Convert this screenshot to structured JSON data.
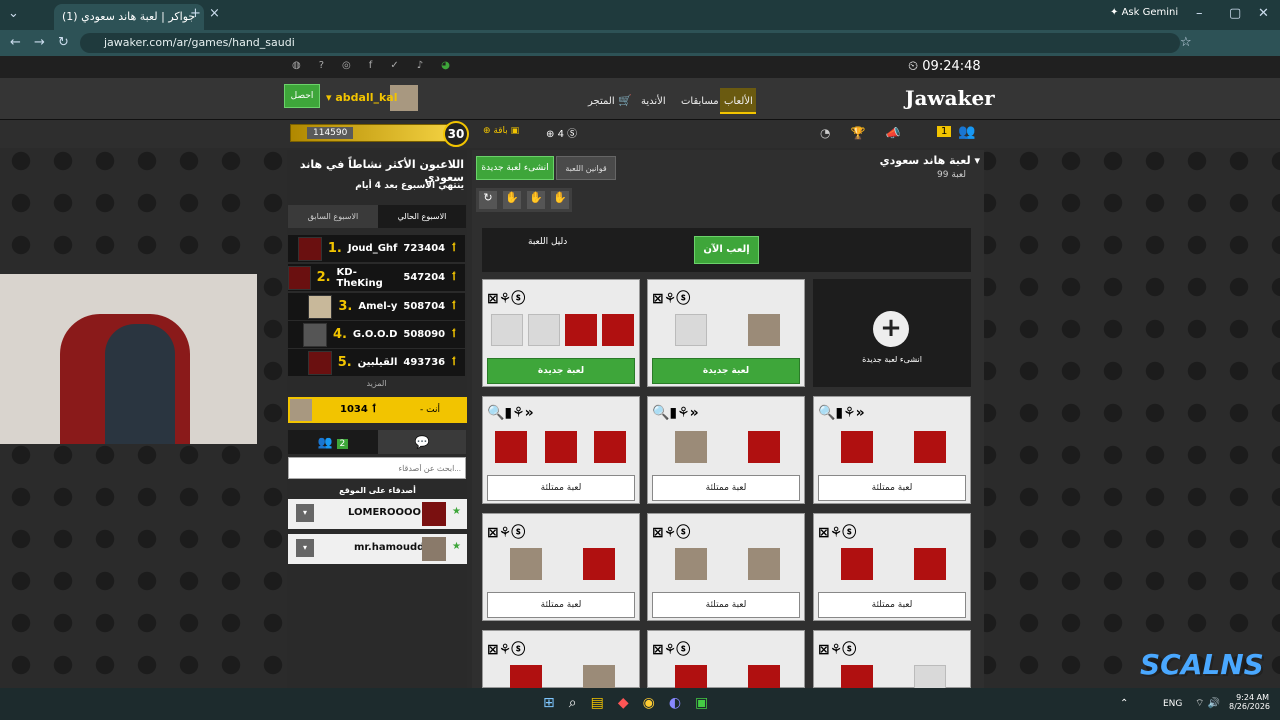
{
  "browser": {
    "tab_title": "(1) جواكر | لعبة هاند سعودي",
    "url": "jawaker.com/ar/games/hand_saudi",
    "ask_gemini": "Ask Gemini"
  },
  "site": {
    "clock": "09:24:48",
    "logo": "Jawaker",
    "nav": [
      "الألعاب",
      "مسابقات",
      "الأندية",
      "المتجر"
    ],
    "username": "abdall_kal",
    "get_button": "احصل",
    "coins": "114590",
    "level": "30",
    "plus_label": "باقة",
    "tokens": "4",
    "badge_count": "1"
  },
  "leaderboard": {
    "title": "اللاعبون الأكثر نشاطاً في هاند سعودي",
    "subtitle": "ينتهي الاسبوع بعد 4 أيام",
    "tab_current": "الاسبوع الحالي",
    "tab_previous": "الاسبوع السابق",
    "rows": [
      {
        "rank": "1.",
        "name": "Joud_Ghf",
        "score": "723404"
      },
      {
        "rank": "2.",
        "name": "KD-TheKing",
        "score": "547204"
      },
      {
        "rank": "3.",
        "name": "Amel-y",
        "score": "508704"
      },
      {
        "rank": "4.",
        "name": "G.O.O.D",
        "score": "508090"
      },
      {
        "rank": "5.",
        "name": "القيلبين",
        "score": "493736"
      }
    ],
    "more": "المزيد",
    "me_label": "- أنت",
    "me_score": "1034"
  },
  "friends": {
    "online_count": "2",
    "search_placeholder": "ابحث عن أصدقاء...",
    "header": "أصدقاء على الموقع",
    "list": [
      "LOMEROOOO",
      "mr.hamoudd"
    ]
  },
  "game": {
    "title": "لعبة هاند سعودي",
    "count": "99 لعبة",
    "create_button": "انشىء لعبة جديدة",
    "rules_button": "قوانين اللعبة",
    "play_now": "إلعب الآن",
    "guide": "دليل اللعبة",
    "create_card_label": "انشىء لعبة جديدة",
    "new_game": "لعبة جديدة",
    "full_game": "لعبة ممتلئة"
  },
  "taskbar": {
    "lang": "ENG",
    "time": "9:24 AM",
    "date": "8/26/2026"
  },
  "colors": {
    "accent_green": "#3ea63a",
    "gold": "#f2c400",
    "chrome_bg": "#1f3a3d"
  }
}
